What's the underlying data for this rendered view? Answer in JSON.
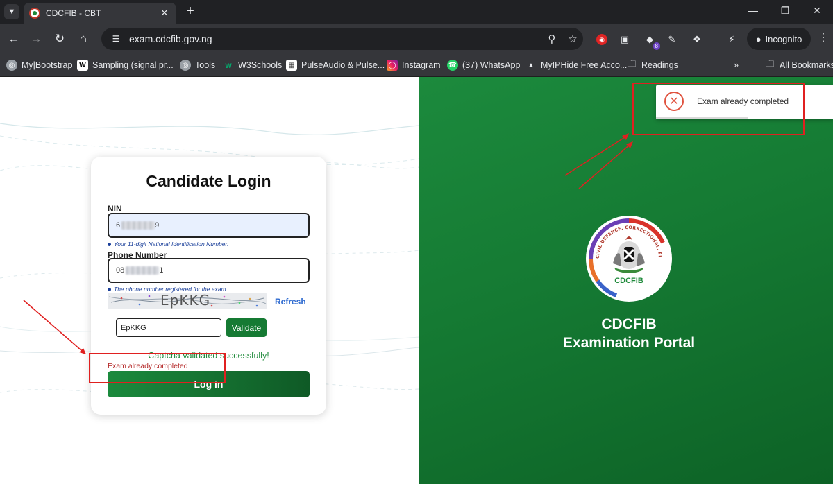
{
  "browser": {
    "tab": {
      "title": "CDCFIB - CBT"
    },
    "address_bar": {
      "url": "exam.cdcfib.gov.ng"
    },
    "extension_badge": "8",
    "profile_label": "Incognito",
    "bookmarks": [
      {
        "label": "My|Bootstrap",
        "icon": "globe-icon"
      },
      {
        "label": "Sampling (signal pr...",
        "icon": "wikipedia-icon"
      },
      {
        "label": "Tools",
        "icon": "globe-icon"
      },
      {
        "label": "W3Schools",
        "icon": "w3schools-icon"
      },
      {
        "label": "PulseAudio & Pulse...",
        "icon": "page-icon"
      },
      {
        "label": "Instagram",
        "icon": "instagram-icon"
      },
      {
        "label": "(37) WhatsApp",
        "icon": "whatsapp-icon"
      },
      {
        "label": "MyIPHide Free Acco...",
        "icon": "spy-icon"
      },
      {
        "label": "Readings",
        "icon": "folder-icon"
      }
    ],
    "all_bookmarks_label": "All Bookmarks"
  },
  "login": {
    "title": "Candidate Login",
    "nin": {
      "label": "NIN",
      "value_prefix": "6",
      "value_suffix": "9",
      "hint": "Your 11-digit National Identification Number."
    },
    "phone": {
      "label": "Phone Number",
      "value_prefix": "08",
      "value_suffix": "1",
      "hint": "The phone number registered for the exam."
    },
    "captcha": {
      "image_text": "EpKKG",
      "refresh_label": "Refresh",
      "input_value": "EpKKG",
      "validate_label": "Validate",
      "success_message": "Captcha validated successfully!"
    },
    "error_message": "Exam already completed",
    "login_label": "Log in"
  },
  "portal": {
    "logo_text": "CDCFIB",
    "logo_ring_text": "CIVIL DEFENCE, CORRECTIONAL, FIRE AND IMMIGRATION SERVICES BOARD",
    "title_line1": "CDCFIB",
    "title_line2": "Examination Portal"
  },
  "toast": {
    "message": "Exam already completed",
    "progress": 0.52
  },
  "colors": {
    "brand_green": "#157a33",
    "error_red": "#b22222",
    "annotation_red": "#e02020",
    "link_blue": "#2f6bd0"
  }
}
